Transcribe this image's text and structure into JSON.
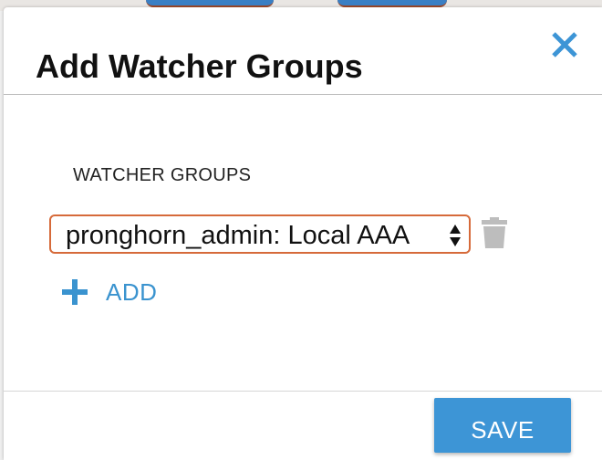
{
  "dialog": {
    "title": "Add Watcher Groups",
    "close_icon": "close-icon",
    "section_label": "WATCHER GROUPS",
    "group_select": {
      "selected_value": "pronghorn_admin: Local AAA"
    },
    "delete_icon": "trash-icon",
    "add_icon": "plus-icon",
    "add_label": "ADD",
    "save_label": "SAVE"
  },
  "colors": {
    "accent": "#3d95d6",
    "select_border": "#d66a3a",
    "icon_gray": "#bdbdbd"
  }
}
